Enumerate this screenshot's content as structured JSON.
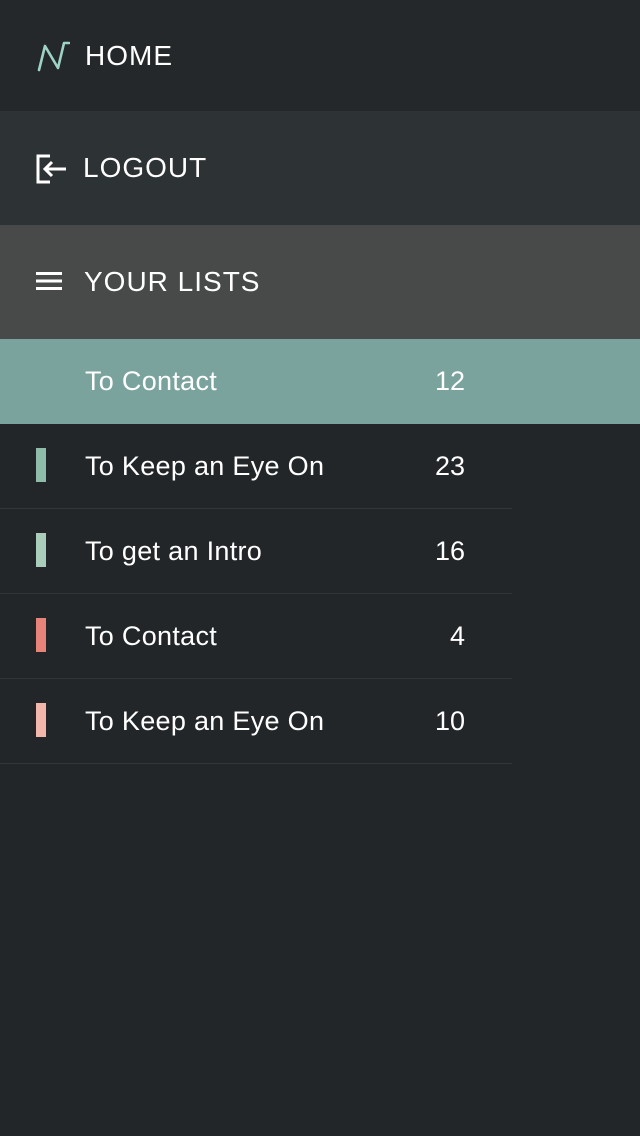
{
  "nav": {
    "home_label": "HOME",
    "logout_label": "LOGOUT",
    "lists_label": "YOUR LISTS"
  },
  "lists": [
    {
      "name": "To Contact",
      "count": "12",
      "active": true,
      "color": ""
    },
    {
      "name": "To Keep an Eye On",
      "count": "23",
      "active": false,
      "color": "#8fbca8"
    },
    {
      "name": "To get an Intro",
      "count": "16",
      "active": false,
      "color": "#a9cdb9"
    },
    {
      "name": "To Contact",
      "count": "4",
      "active": false,
      "color": "#e8837a"
    },
    {
      "name": "To Keep an Eye On",
      "count": "10",
      "active": false,
      "color": "#f2b6ab"
    }
  ],
  "colors": {
    "background": "#222628",
    "active_row": "#7aa39e",
    "logo_accent": "#9ed3c4"
  },
  "icons": {
    "home": "logo-n-icon",
    "logout": "logout-icon",
    "lists": "hamburger-icon"
  }
}
